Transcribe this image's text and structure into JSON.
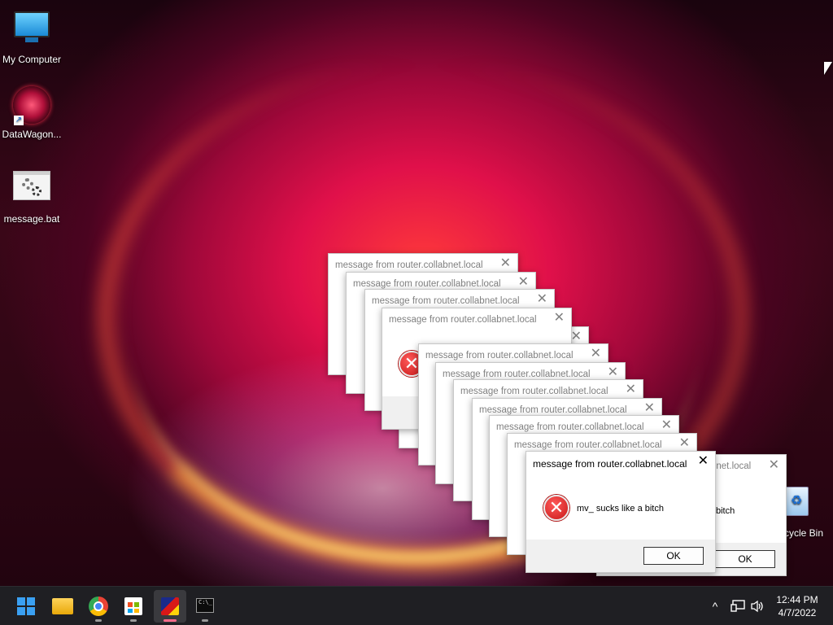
{
  "desktop": {
    "icons": [
      {
        "label": "My Computer",
        "icon": "monitor-icon"
      },
      {
        "label": "DataWagon...",
        "icon": "datawagon-icon"
      },
      {
        "label": "message.bat",
        "icon": "batch-file-icon"
      }
    ],
    "recycle_bin": {
      "label": "cycle Bin",
      "icon": "recycle-bin-icon"
    }
  },
  "dialogs": {
    "title": "message from router.collabnet.local",
    "title_partial": "bnet.local",
    "close_glyph": "✕",
    "message": "mv_ sucks like a bitch",
    "message_partial": "bitch",
    "ok_label": "OK",
    "error_glyph": "✕"
  },
  "taskbar": {
    "apps": [
      {
        "name": "Start",
        "icon": "windows-start-icon"
      },
      {
        "name": "File Explorer",
        "icon": "folder-icon"
      },
      {
        "name": "Google Chrome",
        "icon": "chrome-icon"
      },
      {
        "name": "Microsoft Store",
        "icon": "store-icon"
      },
      {
        "name": "DataWagon",
        "icon": "app-icon",
        "active": true
      },
      {
        "name": "Command Prompt",
        "icon": "terminal-icon"
      }
    ],
    "terminal_glyph": "C:\\_",
    "tray": {
      "chevron": "^",
      "network_icon": "network-icon",
      "volume_icon": "volume-icon"
    },
    "clock": {
      "time": "12:44 PM",
      "date": "4/7/2022"
    }
  },
  "colors": {
    "accent": "#3aa0f2",
    "error_red": "#c81818",
    "taskbar_bg": "#1f1f23"
  }
}
